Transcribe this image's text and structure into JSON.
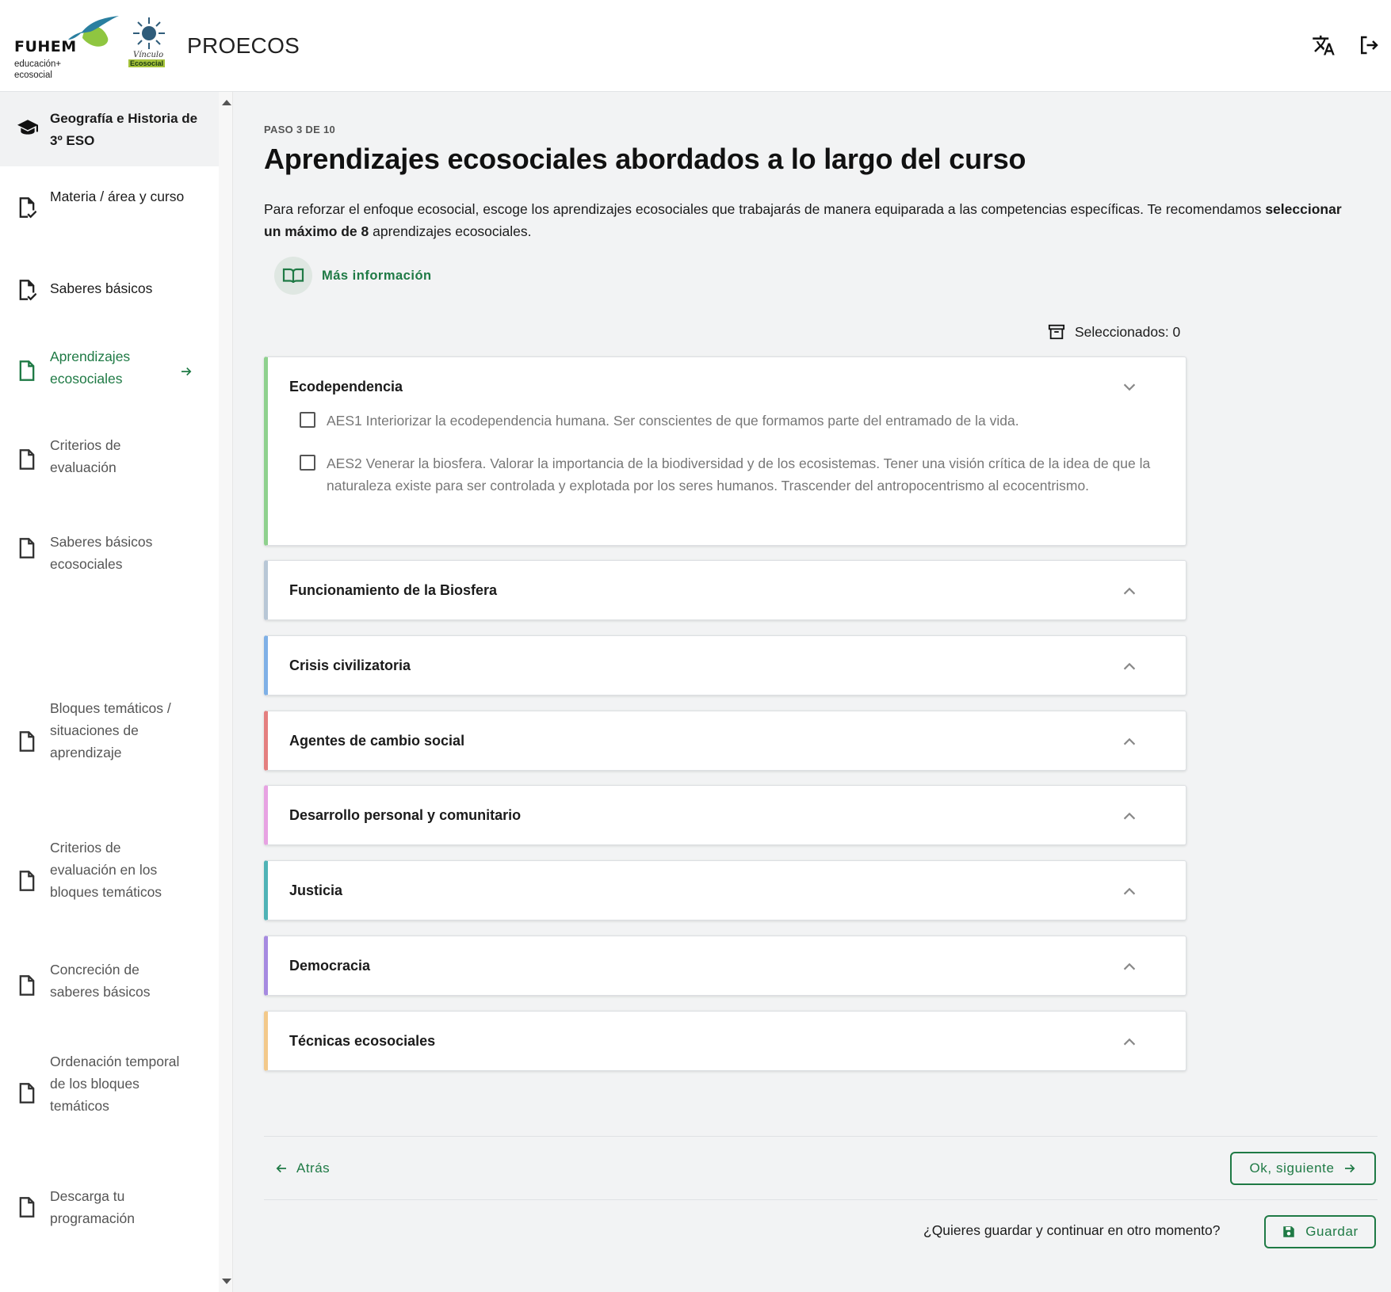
{
  "header": {
    "logo_fuhem": "FUHEM",
    "logo_fuhem_tag_1": "educación+",
    "logo_fuhem_tag_2": "ecosocial",
    "logo_vinculo_1": "Vínculo",
    "logo_vinculo_2": "Ecosocial",
    "app_title": "PROECOS",
    "icons": [
      "translate-icon",
      "logout-icon"
    ]
  },
  "sidebar": {
    "course": "Geografía e Historia de 3º ESO",
    "items": [
      {
        "label": "Materia / área y curso",
        "state": "done",
        "icon": "file-check-icon"
      },
      {
        "label": "Saberes básicos",
        "state": "done",
        "icon": "file-check-icon"
      },
      {
        "label": "Aprendizajes ecosociales",
        "state": "active",
        "icon": "file-icon"
      },
      {
        "label": "Criterios de evaluación",
        "state": "pending",
        "icon": "file-icon"
      },
      {
        "label": "Saberes básicos ecosociales",
        "state": "pending",
        "icon": "file-icon"
      },
      {
        "label": "Bloques temáticos / situaciones de aprendizaje",
        "state": "pending",
        "icon": "file-icon"
      },
      {
        "label": "Criterios de evaluación en los bloques temáticos",
        "state": "pending",
        "icon": "file-icon"
      },
      {
        "label": "Concreción de saberes básicos",
        "state": "pending",
        "icon": "file-icon"
      },
      {
        "label": "Ordenación temporal de los bloques temáticos",
        "state": "pending",
        "icon": "file-icon"
      },
      {
        "label": "Descarga tu programación",
        "state": "pending",
        "icon": "file-icon"
      }
    ]
  },
  "main": {
    "step": "PASO 3 DE 10",
    "title": "Aprendizajes ecosociales abordados a lo largo del curso",
    "intro_part1": "Para reforzar el enfoque ecosocial, escoge los aprendizajes ecosociales que trabajarás de manera equiparada a las competencias específicas. Te recomendamos ",
    "intro_bold": "seleccionar un máximo de 8",
    "intro_part2": " aprendizajes ecosociales.",
    "more_info": "Más información",
    "selected_label": "Seleccionados: 0",
    "sections": [
      {
        "title": "Ecodependencia",
        "color": "#8fd18e",
        "expanded": true,
        "items": [
          {
            "text": "AES1 Interiorizar la ecodependencia humana. Ser conscientes de que formamos parte del entramado de la vida.",
            "checked": false
          },
          {
            "text": "AES2 Venerar la biosfera. Valorar la importancia de la biodiversidad y de los ecosistemas. Tener una visión crítica de la idea de que la naturaleza existe para ser controlada y explotada por los seres humanos. Trascender del antropocentrismo al ecocentrismo.",
            "checked": false
          }
        ]
      },
      {
        "title": "Funcionamiento de la Biosfera",
        "color": "#b8c7d6",
        "expanded": false
      },
      {
        "title": "Crisis civilizatoria",
        "color": "#7fb0e6",
        "expanded": false
      },
      {
        "title": "Agentes de cambio social",
        "color": "#e47f7f",
        "expanded": false
      },
      {
        "title": "Desarrollo personal y comunitario",
        "color": "#e7a2e2",
        "expanded": false
      },
      {
        "title": "Justicia",
        "color": "#4fb3b6",
        "expanded": false
      },
      {
        "title": "Democracia",
        "color": "#a68ae0",
        "expanded": false
      },
      {
        "title": "Técnicas ecosociales",
        "color": "#f3c98a",
        "expanded": false
      }
    ]
  },
  "footer": {
    "back": "Atrás",
    "next": "Ok, siguiente",
    "save_question": "¿Quieres guardar y continuar en otro momento?",
    "save": "Guardar"
  },
  "colors": {
    "accent": "#1f7a45",
    "background": "#f2f3f4"
  }
}
